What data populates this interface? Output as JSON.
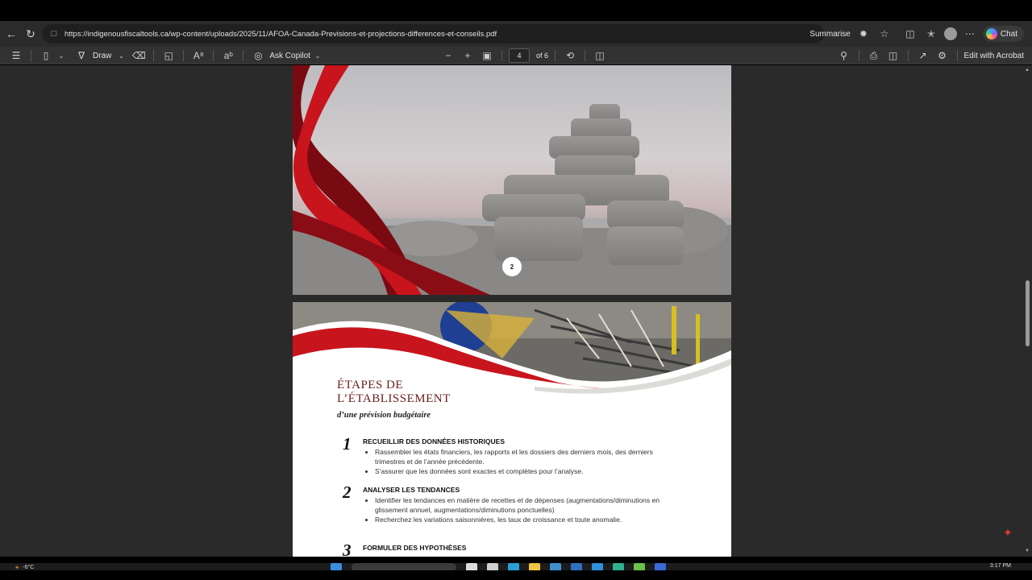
{
  "browser": {
    "url": "https://indigenousfiscaltools.ca/wp-content/uploads/2025/11/AFOA-Canada-Previsions-et-projections-differences-et-conseils.pdf",
    "summarise_label": "Summarise",
    "chat_label": "Chat"
  },
  "pdf_toolbar": {
    "draw_label": "Draw",
    "ask_copilot_label": "Ask Copilot",
    "current_page": "4",
    "page_total": "of 6",
    "edit_with_acrobat_label": "Edit with Acrobat"
  },
  "page1": {
    "page_number": "2"
  },
  "page2": {
    "title_line1": "ÉTAPES DE",
    "title_line2": "L’ÉTABLISSEMENT",
    "subtitle": "d’une prévision budgétaire",
    "steps": [
      {
        "num": "1",
        "heading": "RECUEILLIR DES DONNÉES HISTORIQUES",
        "bullets": [
          "Rassembler les états financiers, les rapports et les dossiers des derniers mois, des derniers trimestres et de l’année précédente.",
          "S’assurer que les données sont exactes et complètes pour l’analyse."
        ]
      },
      {
        "num": "2",
        "heading": "ANALYSER LES TENDANCES",
        "bullets": [
          "Identifier les tendances en matière de recettes et de dépenses (augmentations/diminutions en glissement annuel, augmentations/diminutions ponctuelles)",
          "Recherchez les variations saisonnières, les taux de croissance et toute anomalie."
        ]
      },
      {
        "num": "3",
        "heading": "FORMULER DES HYPOTHÈSES",
        "bullets": []
      }
    ]
  },
  "taskbar": {
    "weather": "-6°C",
    "time": "3:17 PM"
  },
  "colors": {
    "accent_red": "#c8141c",
    "dark_red": "#7a0a12",
    "title_maroon": "#6b1c1c"
  }
}
